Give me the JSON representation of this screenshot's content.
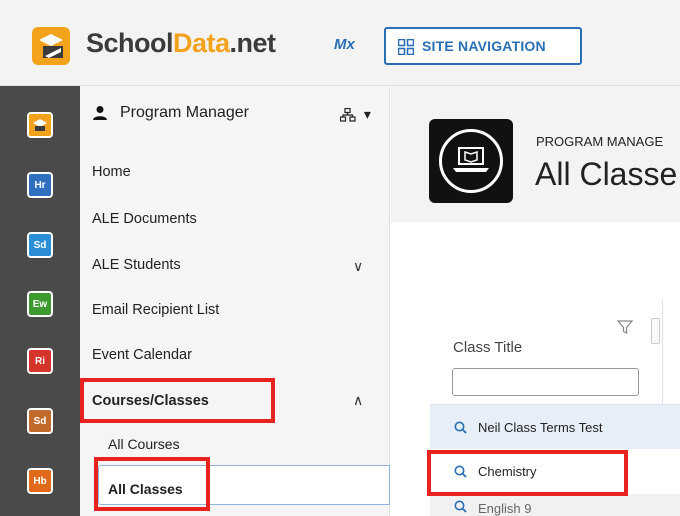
{
  "header": {
    "logo_part1": "School",
    "logo_part2": "Data",
    "logo_part3": ".net",
    "mx_label": "Mx",
    "site_nav_label": "SITE NAVIGATION"
  },
  "rail": {
    "apps": [
      {
        "label": "Hr",
        "color": "#2f6fbf"
      },
      {
        "label": "Sd",
        "color": "#2a8fd6"
      },
      {
        "label": "Ew",
        "color": "#3d9a2f"
      },
      {
        "label": "Ri",
        "color": "#d6332a"
      },
      {
        "label": "Sd",
        "color": "#c06a2b"
      },
      {
        "label": "Hb",
        "color": "#e06a1a"
      }
    ]
  },
  "menu": {
    "role": "Program Manager",
    "items": [
      {
        "label": "Home"
      },
      {
        "label": "ALE Documents"
      },
      {
        "label": "ALE Students"
      },
      {
        "label": "Email Recipient List"
      },
      {
        "label": "Event Calendar"
      },
      {
        "label": "Courses/Classes"
      }
    ],
    "sub_items": [
      {
        "label": "All Courses"
      },
      {
        "label": "All Classes"
      }
    ],
    "chevron_down": "∨",
    "chevron_up": "∧"
  },
  "main": {
    "breadcrumb": "PROGRAM MANAGE",
    "title": "All Classe",
    "column_title": "Class Title",
    "filter_value": "",
    "rows": [
      {
        "title": "Neil Class Terms Test"
      },
      {
        "title": "Chemistry"
      },
      {
        "title": "English 9"
      }
    ]
  },
  "colors": {
    "accent": "#2a6fb5",
    "brand_orange": "#f3a21c",
    "highlight": "#e8231f"
  }
}
